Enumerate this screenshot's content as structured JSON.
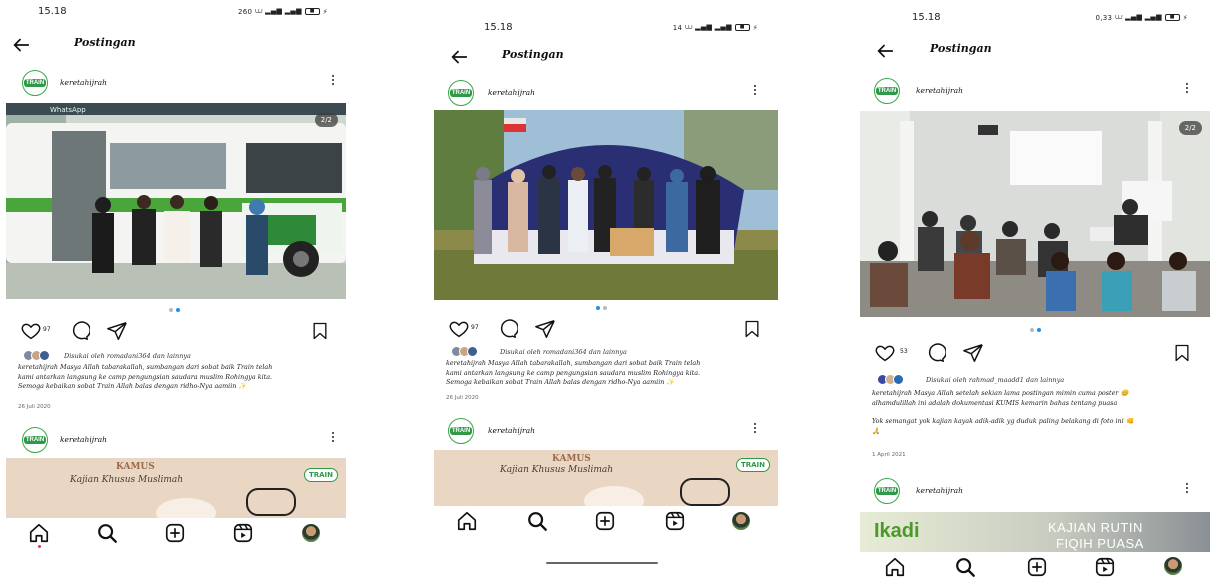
{
  "phones": [
    {
      "time": "15.18",
      "status_speed": "260",
      "signal": "⩊ 𝔅𝔩 .ıl 4G .ıl",
      "battery": "",
      "header_title": "Postingan",
      "post": {
        "username": "keretahijrah",
        "counter": "2/2",
        "bus_banner": "WhatsApp",
        "likes": "97",
        "liked_by": "Disukai oleh romadani364 dan lainnya",
        "caption": [
          "keretahijrah Masya Allah tabarakallah, sumbangan dari sobat baik Train telah",
          "kami antarkan langsung ke camp pengungsian saudara muslim Rohingya kita.",
          "Semoga kebaikan sobat Train Allah balas dengan ridho-Nya aamiin ✨"
        ],
        "date": "26 Juli 2020"
      },
      "next_post": {
        "username": "keretahijrah",
        "banner_title": "KAMUS",
        "banner_subtitle": "Kajian Khusus Muslimah",
        "logo": "TRAIN"
      }
    },
    {
      "time": "15.18",
      "status_speed": "14",
      "header_title": "Postingan",
      "post": {
        "username": "keretahijrah",
        "likes": "97",
        "liked_by": "Disukai oleh romadani364 dan lainnya",
        "caption": [
          "keretahijrah Masya Allah tabarakallah, sumbangan dari sobat baik Train telah",
          "kami antarkan langsung ke camp pengungsian saudara muslim Rohingya kita.",
          "Semoga kebaikan sobat Train Allah balas dengan ridho-Nya aamiin ✨"
        ],
        "date": "26 Juli 2020"
      },
      "next_post": {
        "username": "keretahijrah",
        "banner_title": "KAMUS",
        "banner_subtitle": "Kajian Khusus Muslimah",
        "logo": "TRAIN"
      }
    },
    {
      "time": "15.18",
      "status_speed": "0,33",
      "header_title": "Postingan",
      "post": {
        "username": "keretahijrah",
        "counter": "2/2",
        "likes": "53",
        "liked_by": "Disukai oleh rahmad_maadd1 dan lainnya",
        "caption": [
          "keretahijrah Masya Allah setelah sekian lama postingan mimin cuma poster 😊",
          "alhamdulillah ini adalah dokumentasi KUMIS kemarin bahas tentang puasa",
          "",
          "Yok semangat yok kajian kayak adik-adik yg duduk paling belakang di foto ini 👊",
          "🙏"
        ],
        "date": "1 April 2021"
      },
      "next_post": {
        "username": "keretahijrah",
        "banner_left": "Ikadi",
        "banner_title": "KAJIAN RUTIN",
        "banner_subtitle": "FIQIH PUASA"
      }
    }
  ],
  "icons": {
    "back": "back-arrow-icon",
    "more": "more-vertical-icon",
    "like": "heart-icon",
    "comment": "comment-icon",
    "share": "send-icon",
    "save": "bookmark-icon",
    "home": "home-icon",
    "search": "search-icon",
    "create": "add-post-icon",
    "reels": "reels-icon"
  },
  "colors": {
    "accent_dot": "#1e90e8",
    "train_green": "#2e9a47"
  }
}
